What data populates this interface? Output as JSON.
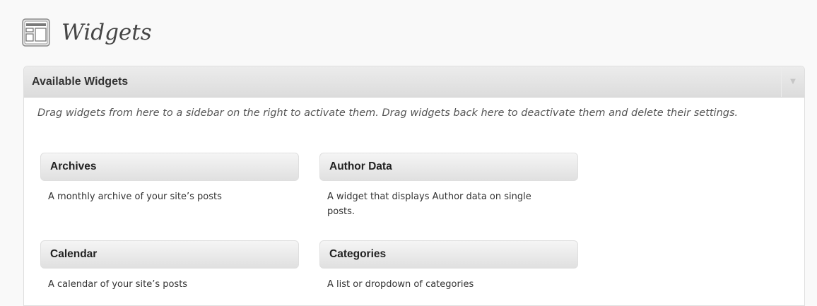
{
  "header": {
    "title": "Widgets",
    "icon": "widgets-icon"
  },
  "panel": {
    "title": "Available Widgets",
    "toggle_icon": "triangle-down-icon",
    "description": "Drag widgets from here to a sidebar on the right to activate them. Drag widgets back here to deactivate them and delete their settings."
  },
  "widgets": [
    {
      "title": "Archives",
      "description": "A monthly archive of your site’s posts"
    },
    {
      "title": "Author Data",
      "description": "A widget that displays Author data on single posts."
    },
    {
      "title": "Calendar",
      "description": "A calendar of your site’s posts"
    },
    {
      "title": "Categories",
      "description": "A list or dropdown of categories"
    }
  ],
  "colors": {
    "background": "#f9f9f9",
    "panel_header": "#dcdcdc",
    "title_text": "#464646"
  }
}
